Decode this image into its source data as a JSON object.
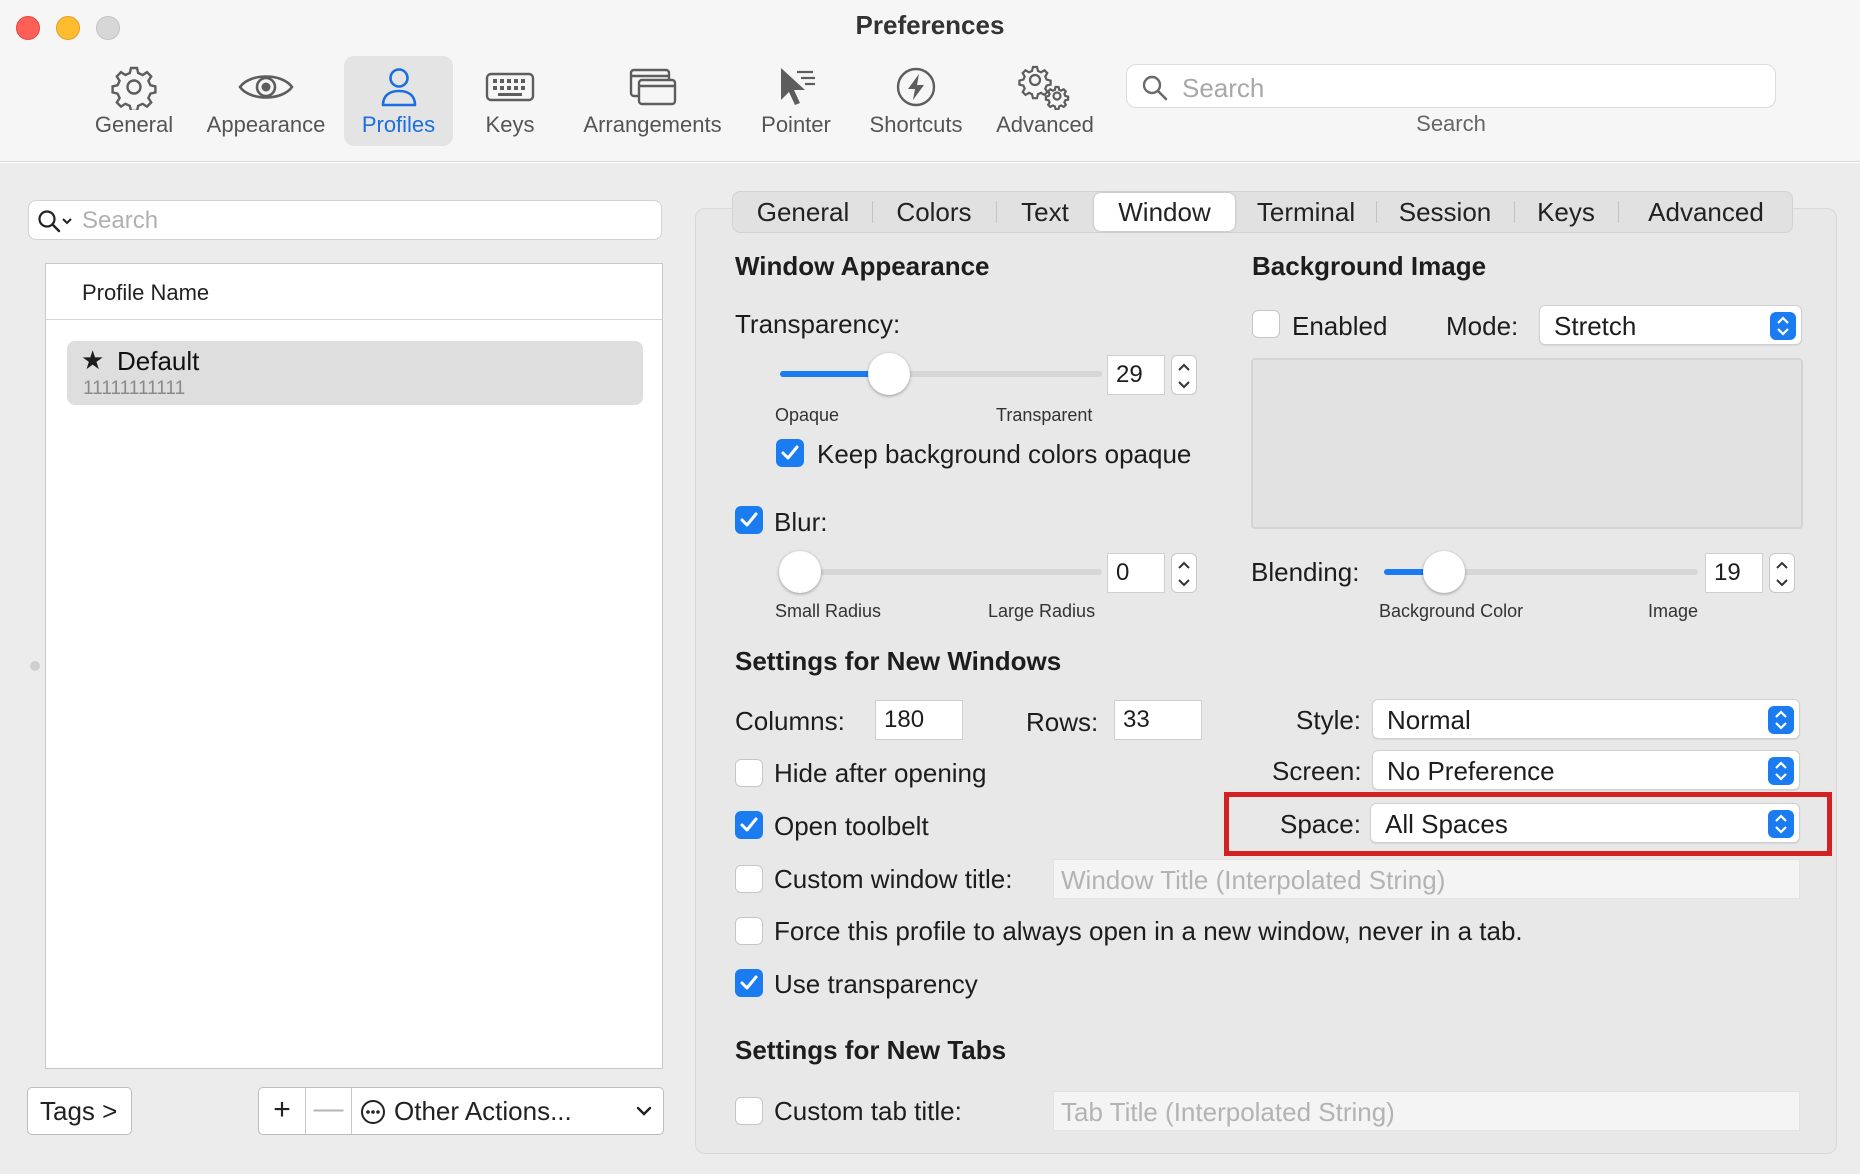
{
  "window": {
    "title": "Preferences",
    "traffic_lights": {
      "close": "#fe5f57",
      "minimize": "#febc2e",
      "zoom": "#d7d7d7"
    }
  },
  "toolbar": {
    "items": [
      {
        "label": "General",
        "icon": "gear-icon"
      },
      {
        "label": "Appearance",
        "icon": "eye-icon"
      },
      {
        "label": "Profiles",
        "icon": "person-icon",
        "active": true
      },
      {
        "label": "Keys",
        "icon": "keyboard-icon"
      },
      {
        "label": "Arrangements",
        "icon": "windows-icon"
      },
      {
        "label": "Pointer",
        "icon": "pointer-icon"
      },
      {
        "label": "Shortcuts",
        "icon": "bolt-icon"
      },
      {
        "label": "Advanced",
        "icon": "gears-icon"
      }
    ],
    "search_placeholder": "Search",
    "search_caption": "Search",
    "accent": "#1a6fe0"
  },
  "profiles": {
    "search_placeholder": "Search",
    "column_header": "Profile Name",
    "items": [
      {
        "name": "Default",
        "guid": "11111111111",
        "is_default": true
      }
    ],
    "tags_button": "Tags >",
    "add_label": "+",
    "remove_label": "—",
    "other_actions": "Other Actions..."
  },
  "tabs": [
    "General",
    "Colors",
    "Text",
    "Window",
    "Terminal",
    "Session",
    "Keys",
    "Advanced"
  ],
  "active_tab": "Window",
  "window_appearance": {
    "heading": "Window Appearance",
    "transparency_label": "Transparency:",
    "transparency_value": "29",
    "transparency_min_label": "Opaque",
    "transparency_max_label": "Transparent",
    "keep_bg_opaque_label": "Keep background colors opaque",
    "keep_bg_opaque": true,
    "blur_label": "Blur:",
    "blur": true,
    "blur_value": "0",
    "blur_min_label": "Small Radius",
    "blur_max_label": "Large Radius"
  },
  "background_image": {
    "heading": "Background Image",
    "enabled_label": "Enabled",
    "enabled": false,
    "mode_label": "Mode:",
    "mode_value": "Stretch",
    "blending_label": "Blending:",
    "blending_value": "19",
    "blending_min_label": "Background Color",
    "blending_max_label": "Image"
  },
  "new_windows": {
    "heading": "Settings for New Windows",
    "columns_label": "Columns:",
    "columns_value": "180",
    "rows_label": "Rows:",
    "rows_value": "33",
    "style_label": "Style:",
    "style_value": "Normal",
    "screen_label": "Screen:",
    "screen_value": "No Preference",
    "space_label": "Space:",
    "space_value": "All Spaces",
    "hide_after_opening_label": "Hide after opening",
    "hide_after_opening": false,
    "open_toolbelt_label": "Open toolbelt",
    "open_toolbelt": true,
    "custom_title_label": "Custom window title:",
    "custom_title_placeholder": "Window Title (Interpolated String)",
    "custom_title": false,
    "force_new_window_label": "Force this profile to always open in a new window, never in a tab.",
    "force_new_window": false,
    "use_transparency_label": "Use transparency",
    "use_transparency": true
  },
  "new_tabs": {
    "heading": "Settings for New Tabs",
    "custom_tab_title_label": "Custom tab title:",
    "custom_tab_title_placeholder": "Tab Title (Interpolated String)",
    "custom_tab_title": false
  },
  "colors": {
    "checkbox_accent": "#1b7cf2",
    "highlight": "#d32020"
  }
}
